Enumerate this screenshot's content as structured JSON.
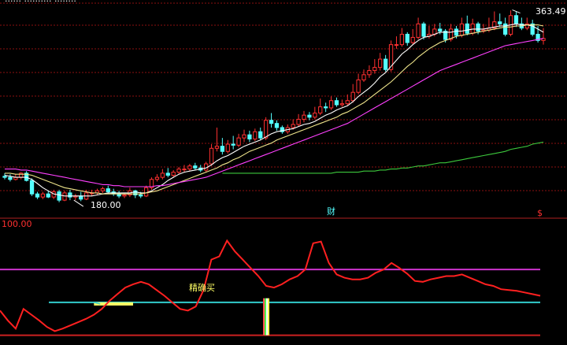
{
  "colors": {
    "background": "#000000",
    "grid": "#8c1010",
    "up_candle": "#ff3030",
    "down_candle": "#54ffff",
    "ma_short": "#ffffff",
    "ma_mid": "#f0e68c",
    "ma_long": "#ff40ff",
    "ma_xlong": "#3cc83c",
    "indicator_line": "#ff2020",
    "level_top": "#cc33cc",
    "level_mid": "#33cccc",
    "level_bottom": "#cc2020",
    "buy_zone": "#ffff66",
    "text_white": "#ffffff",
    "text_yellow": "#ffff66"
  },
  "labels": {
    "header_partial": "...... .......... ........",
    "price_high": "363.49",
    "price_low": "180.00",
    "indicator_max": "100.00",
    "fin_marker": "财",
    "dollar_marker": "$",
    "buy_signal": "精确买"
  },
  "chart_data": [
    {
      "type": "candlestick",
      "title": "",
      "x": [
        1,
        2,
        3,
        4,
        5,
        6,
        7,
        8,
        9,
        10,
        11,
        12,
        13,
        14,
        15,
        16,
        17,
        18,
        19,
        20,
        21,
        22,
        23,
        24,
        25,
        26,
        27,
        28,
        29,
        30,
        31,
        32,
        33,
        34,
        35,
        36,
        37,
        38,
        39,
        40,
        41,
        42,
        43,
        44,
        45,
        46,
        47,
        48,
        49,
        50,
        51,
        52,
        53,
        54,
        55,
        56,
        57,
        58,
        59,
        60,
        61,
        62,
        63,
        64,
        65,
        66,
        67,
        68,
        69,
        70,
        71,
        72,
        73,
        74,
        75,
        76,
        77,
        78,
        79,
        80,
        81,
        82,
        83,
        84,
        85,
        86,
        87,
        88,
        89,
        90,
        91,
        92,
        93,
        94,
        95,
        96,
        97,
        98,
        99,
        100
      ],
      "open": [
        203,
        202,
        200,
        202,
        206,
        199,
        186,
        183,
        186,
        183,
        188,
        180,
        187,
        183,
        184,
        181,
        187,
        187,
        189,
        191,
        188,
        186,
        184,
        185,
        189,
        185,
        184,
        192,
        200,
        202,
        206,
        204,
        207,
        210,
        210,
        213,
        211,
        209,
        215,
        230,
        232,
        227,
        234,
        233,
        240,
        243,
        239,
        246,
        240,
        257,
        254,
        250,
        246,
        250,
        253,
        258,
        262,
        260,
        264,
        270,
        269,
        276,
        272,
        273,
        276,
        284,
        296,
        301,
        305,
        308,
        316,
        306,
        330,
        330,
        340,
        332,
        337,
        350,
        338,
        340,
        345,
        343,
        335,
        345,
        339,
        350,
        341,
        350,
        343,
        344,
        346,
        352,
        350,
        340,
        358,
        350,
        346,
        350,
        340,
        334
      ],
      "close": [
        202,
        200,
        202,
        206,
        199,
        186,
        183,
        186,
        183,
        188,
        180,
        187,
        183,
        184,
        181,
        187,
        187,
        189,
        191,
        188,
        186,
        184,
        185,
        189,
        185,
        184,
        192,
        200,
        202,
        206,
        204,
        207,
        210,
        210,
        213,
        211,
        209,
        215,
        230,
        232,
        227,
        234,
        233,
        240,
        243,
        239,
        246,
        240,
        257,
        254,
        250,
        246,
        250,
        253,
        258,
        262,
        260,
        264,
        270,
        269,
        276,
        272,
        273,
        276,
        284,
        296,
        301,
        305,
        308,
        316,
        306,
        330,
        330,
        340,
        332,
        337,
        350,
        338,
        340,
        345,
        343,
        335,
        345,
        339,
        350,
        341,
        350,
        343,
        344,
        346,
        352,
        350,
        340,
        358,
        350,
        346,
        350,
        340,
        334,
        336
      ],
      "high": [
        206,
        205,
        205,
        207,
        208,
        201,
        188,
        188,
        189,
        190,
        190,
        189,
        190,
        186,
        188,
        190,
        190,
        191,
        193,
        194,
        191,
        189,
        187,
        192,
        190,
        188,
        194,
        202,
        205,
        210,
        211,
        209,
        212,
        214,
        215,
        216,
        214,
        217,
        234,
        250,
        240,
        238,
        242,
        244,
        248,
        247,
        249,
        250,
        260,
        264,
        257,
        252,
        253,
        258,
        263,
        266,
        265,
        270,
        278,
        274,
        280,
        279,
        277,
        282,
        292,
        302,
        306,
        310,
        316,
        322,
        320,
        334,
        338,
        346,
        342,
        345,
        356,
        352,
        348,
        350,
        351,
        345,
        350,
        348,
        356,
        358,
        355,
        352,
        350,
        356,
        362,
        360,
        356,
        363,
        362,
        356,
        356,
        354,
        348,
        346
      ],
      "low": [
        200,
        198,
        199,
        200,
        198,
        184,
        181,
        181,
        182,
        181,
        178,
        179,
        180,
        180,
        179,
        180,
        184,
        185,
        187,
        186,
        184,
        182,
        182,
        183,
        182,
        182,
        183,
        190,
        198,
        200,
        202,
        202,
        205,
        207,
        208,
        209,
        207,
        207,
        213,
        227,
        224,
        225,
        229,
        231,
        236,
        236,
        237,
        238,
        238,
        250,
        247,
        244,
        244,
        248,
        251,
        255,
        257,
        258,
        262,
        265,
        267,
        270,
        270,
        271,
        274,
        282,
        294,
        298,
        302,
        305,
        304,
        304,
        326,
        328,
        329,
        330,
        335,
        335,
        336,
        338,
        340,
        332,
        333,
        336,
        337,
        339,
        339,
        340,
        341,
        342,
        344,
        347,
        338,
        338,
        347,
        344,
        344,
        338,
        332,
        330
      ],
      "ma_short": [
        204,
        203,
        202,
        202,
        202,
        200,
        196,
        192,
        189,
        186,
        185,
        184,
        184,
        184,
        184,
        184,
        184,
        185,
        186,
        187,
        187,
        187,
        187,
        187,
        188,
        187,
        187,
        189,
        192,
        195,
        199,
        202,
        205,
        207,
        208,
        209,
        210,
        211,
        214,
        218,
        221,
        223,
        226,
        229,
        232,
        234,
        236,
        238,
        241,
        244,
        246,
        247,
        248,
        249,
        251,
        253,
        254,
        256,
        259,
        262,
        264,
        267,
        269,
        271,
        275,
        280,
        284,
        288,
        293,
        299,
        303,
        309,
        315,
        321,
        325,
        330,
        334,
        337,
        338,
        340,
        342,
        342,
        342,
        343,
        343,
        344,
        345,
        345,
        345,
        346,
        347,
        348,
        348,
        349,
        350,
        349,
        349,
        348,
        345,
        342
      ],
      "ma_mid": [
        206,
        206,
        205,
        205,
        205,
        204,
        202,
        200,
        198,
        196,
        194,
        192,
        191,
        190,
        189,
        188,
        187,
        187,
        186,
        186,
        186,
        186,
        186,
        186,
        186,
        186,
        187,
        188,
        189,
        191,
        193,
        195,
        197,
        199,
        201,
        203,
        205,
        207,
        209,
        211,
        214,
        216,
        219,
        221,
        224,
        227,
        229,
        231,
        233,
        235,
        238,
        240,
        242,
        244,
        246,
        248,
        250,
        252,
        254,
        256,
        258,
        260,
        263,
        265,
        268,
        271,
        274,
        278,
        282,
        286,
        290,
        294,
        299,
        304,
        309,
        313,
        318,
        322,
        326,
        329,
        332,
        334,
        336,
        338,
        339,
        340,
        341,
        342,
        343,
        344,
        345,
        346,
        347,
        347,
        348,
        348,
        349,
        349,
        349,
        348
      ],
      "ma_long": [
        210,
        210,
        210,
        209,
        209,
        208,
        207,
        206,
        205,
        204,
        203,
        202,
        201,
        200,
        199,
        198,
        197,
        196,
        195,
        195,
        194,
        194,
        193,
        193,
        193,
        193,
        193,
        193,
        194,
        194,
        195,
        196,
        197,
        198,
        199,
        200,
        201,
        202,
        204,
        206,
        208,
        210,
        212,
        214,
        216,
        218,
        220,
        222,
        224,
        226,
        228,
        230,
        232,
        234,
        236,
        238,
        240,
        242,
        244,
        246,
        248,
        250,
        252,
        254,
        257,
        260,
        263,
        266,
        269,
        272,
        275,
        278,
        281,
        284,
        287,
        290,
        293,
        296,
        299,
        302,
        305,
        307,
        309,
        311,
        313,
        315,
        317,
        319,
        321,
        323,
        325,
        327,
        329,
        330,
        331,
        332,
        333,
        334,
        335,
        336
      ],
      "ma_xlong": [
        null,
        null,
        null,
        null,
        null,
        null,
        null,
        null,
        null,
        null,
        null,
        null,
        null,
        null,
        null,
        null,
        null,
        null,
        null,
        null,
        null,
        null,
        null,
        null,
        null,
        null,
        null,
        null,
        null,
        null,
        null,
        null,
        null,
        null,
        null,
        null,
        null,
        null,
        null,
        null,
        206,
        206,
        206,
        206,
        206,
        206,
        206,
        206,
        206,
        206,
        206,
        206,
        206,
        206,
        206,
        206,
        206,
        206,
        206,
        206,
        206,
        207,
        207,
        207,
        207,
        207,
        208,
        208,
        208,
        209,
        209,
        210,
        210,
        211,
        211,
        212,
        213,
        213,
        214,
        215,
        216,
        216,
        217,
        218,
        219,
        220,
        221,
        222,
        223,
        224,
        225,
        226,
        227,
        229,
        230,
        231,
        232,
        234,
        235,
        236
      ],
      "ylim": [
        174,
        370
      ],
      "annotations": [
        {
          "x": 14,
          "y": 180.0,
          "text": "180.00"
        },
        {
          "x": 94,
          "y": 363.49,
          "text": "363.49"
        }
      ],
      "grid": true
    },
    {
      "type": "line",
      "title": "",
      "series": [
        {
          "values": [
            30,
            18,
            8,
            32,
            25,
            18,
            10,
            5,
            8,
            12,
            16,
            20,
            25,
            32,
            42,
            50,
            58,
            62,
            65,
            62,
            55,
            48,
            40,
            32,
            30,
            35,
            55,
            92,
            96,
            115,
            102,
            92,
            82,
            72,
            60,
            58,
            62,
            68,
            72,
            80,
            112,
            114,
            88,
            74,
            70,
            68,
            68,
            70,
            76,
            80,
            88,
            82,
            75,
            66,
            65,
            68,
            70,
            72,
            72,
            74,
            70,
            66,
            62,
            60,
            56,
            55,
            54,
            52,
            50,
            48
          ]
        }
      ],
      "levels": [
        {
          "value": 80
        },
        {
          "value": 40
        },
        {
          "value": 0
        }
      ],
      "buy_zones": [
        {
          "x_start": 12,
          "x_end": 17
        }
      ],
      "signals": [
        {
          "x": 34,
          "text": "精确买"
        }
      ],
      "ylim": [
        -10,
        130
      ],
      "grid": false
    }
  ]
}
